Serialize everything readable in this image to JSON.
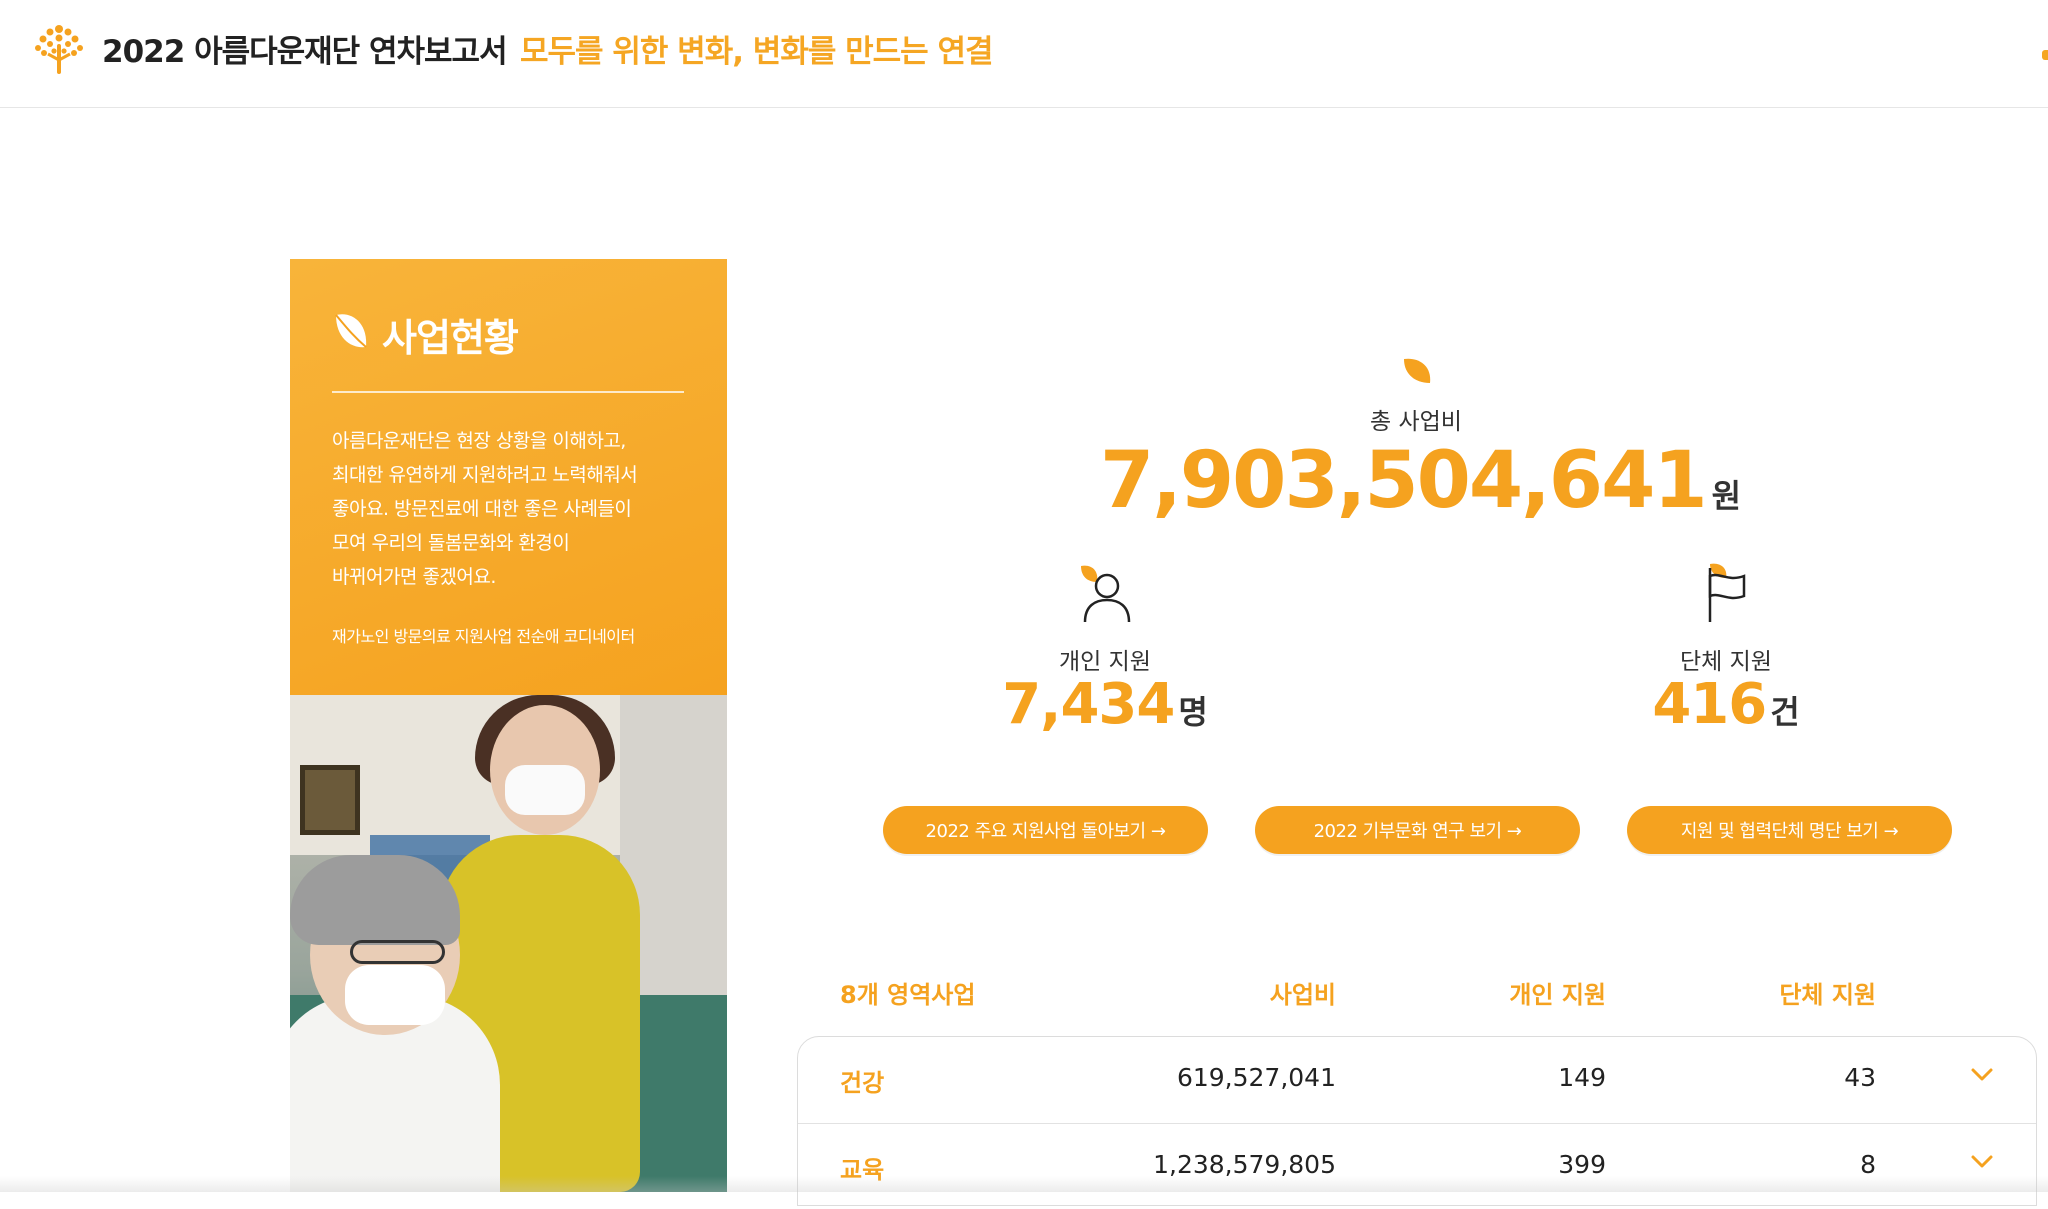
{
  "header": {
    "title": "2022 아름다운재단 연차보고서",
    "slogan": "모두를 위한 변화, 변화를 만드는 연결"
  },
  "colors": {
    "accent": "#f5a21f",
    "text": "#222222"
  },
  "card": {
    "title": "사업현황",
    "quote_lines": [
      "아름다운재단은 현장 상황을 이해하고,",
      "최대한 유연하게 지원하려고 노력해줘서",
      "좋아요. 방문진료에 대한 좋은 사례들이",
      "모여 우리의 돌봄문화와 환경이",
      "바뀌어가면 좋겠어요."
    ],
    "credit": "재가노인 방문의료 지원사업 전순애 코디네이터"
  },
  "stats": {
    "total_label": "총 사업비",
    "total_value": "7,903,504,641",
    "total_unit": "원",
    "individual_label": "개인 지원",
    "individual_value": "7,434",
    "individual_unit": "명",
    "group_label": "단체 지원",
    "group_value": "416",
    "group_unit": "건"
  },
  "buttons": [
    "2022 주요 지원사업 돌아보기 →",
    "2022 기부문화 연구 보기 →",
    "지원 및 협력단체 명단 보기 →"
  ],
  "table": {
    "headers": [
      "8개 영역사업",
      "사업비",
      "개인 지원",
      "단체 지원"
    ],
    "rows": [
      {
        "name": "건강",
        "budget": "619,527,041",
        "individual": "149",
        "group": "43"
      },
      {
        "name": "교육",
        "budget": "1,238,579,805",
        "individual": "399",
        "group": "8"
      }
    ]
  }
}
